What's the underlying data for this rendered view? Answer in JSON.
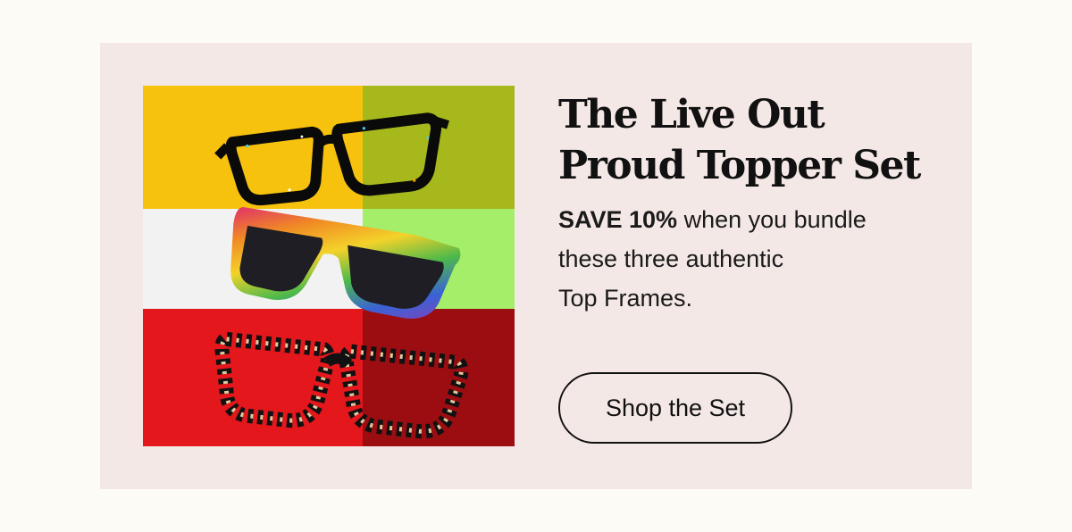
{
  "promo": {
    "headline_line1": "The Live Out",
    "headline_line2": "Proud Topper Set",
    "body_bold": "SAVE 10%",
    "body_line1_rest": " when you bundle",
    "body_line2": "these three authentic",
    "body_line3": "Top Frames.",
    "cta_label": "Shop the Set"
  },
  "colors": {
    "page_background": "#fdfbf6",
    "card_background": "#f4e8e6",
    "text": "#111111"
  }
}
